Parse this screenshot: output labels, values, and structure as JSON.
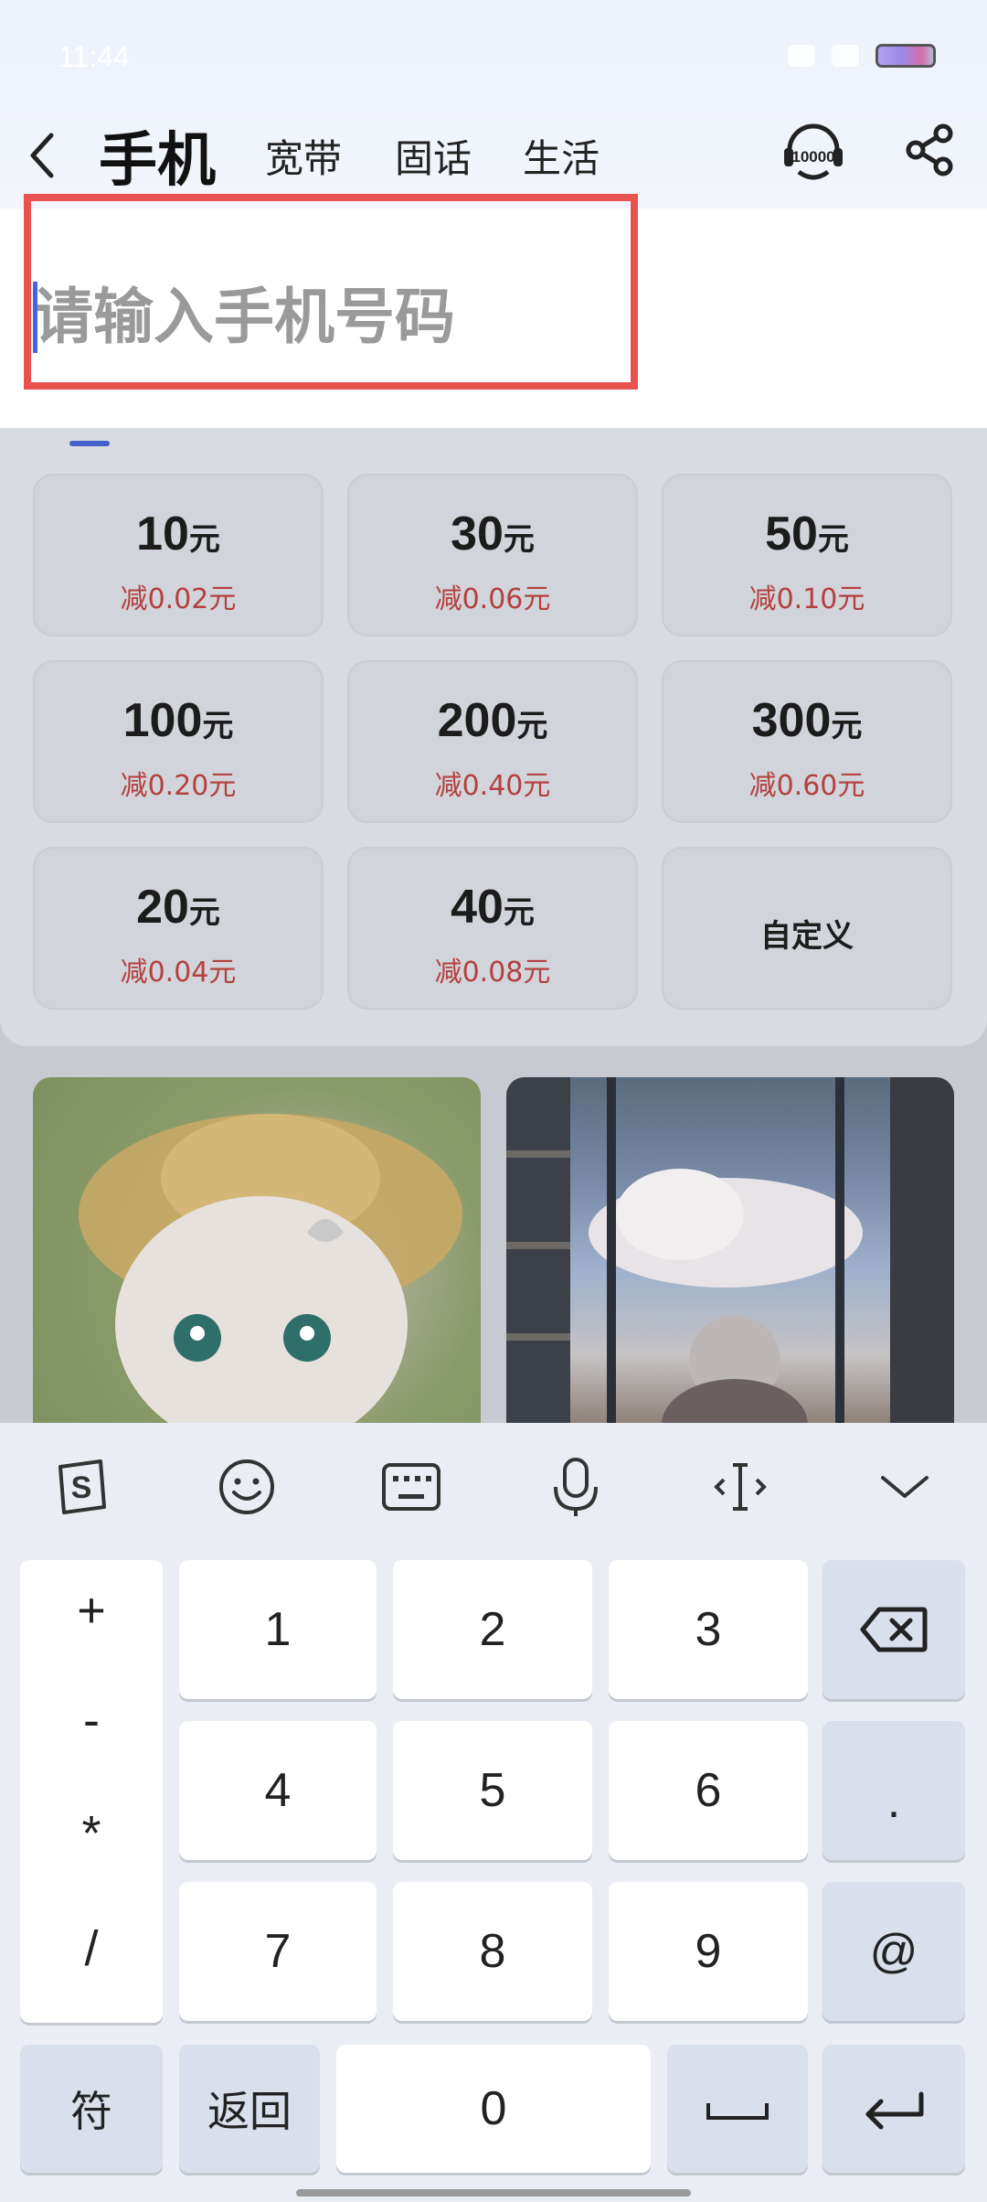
{
  "status": {
    "time": "11:44"
  },
  "header": {
    "tabs": [
      {
        "label": "手机",
        "active": true
      },
      {
        "label": "宽带"
      },
      {
        "label": "固话"
      },
      {
        "label": "生活"
      }
    ],
    "service_icon_text": "10000"
  },
  "phone_input": {
    "placeholder": "请输入手机号码",
    "value": ""
  },
  "amounts": [
    {
      "value": "10",
      "unit": "元",
      "discount": "减0.02元"
    },
    {
      "value": "30",
      "unit": "元",
      "discount": "减0.06元"
    },
    {
      "value": "50",
      "unit": "元",
      "discount": "减0.10元"
    },
    {
      "value": "100",
      "unit": "元",
      "discount": "减0.20元"
    },
    {
      "value": "200",
      "unit": "元",
      "discount": "减0.40元"
    },
    {
      "value": "300",
      "unit": "元",
      "discount": "减0.60元"
    },
    {
      "value": "20",
      "unit": "元",
      "discount": "减0.04元"
    },
    {
      "value": "40",
      "unit": "元",
      "discount": "减0.08元"
    }
  ],
  "custom_amount_label": "自定义",
  "keyboard": {
    "toolbar": [
      "sogou-logo-icon",
      "emoji-icon",
      "keyboard-icon",
      "microphone-icon",
      "cursor-icon",
      "collapse-icon"
    ],
    "symbols": [
      "+",
      "-",
      "*",
      "/"
    ],
    "digits": [
      "1",
      "2",
      "3",
      "4",
      "5",
      "6",
      "7",
      "8",
      "9",
      "0"
    ],
    "dot": ".",
    "at": "@",
    "symbol_key": "符",
    "back_key": "返回"
  }
}
